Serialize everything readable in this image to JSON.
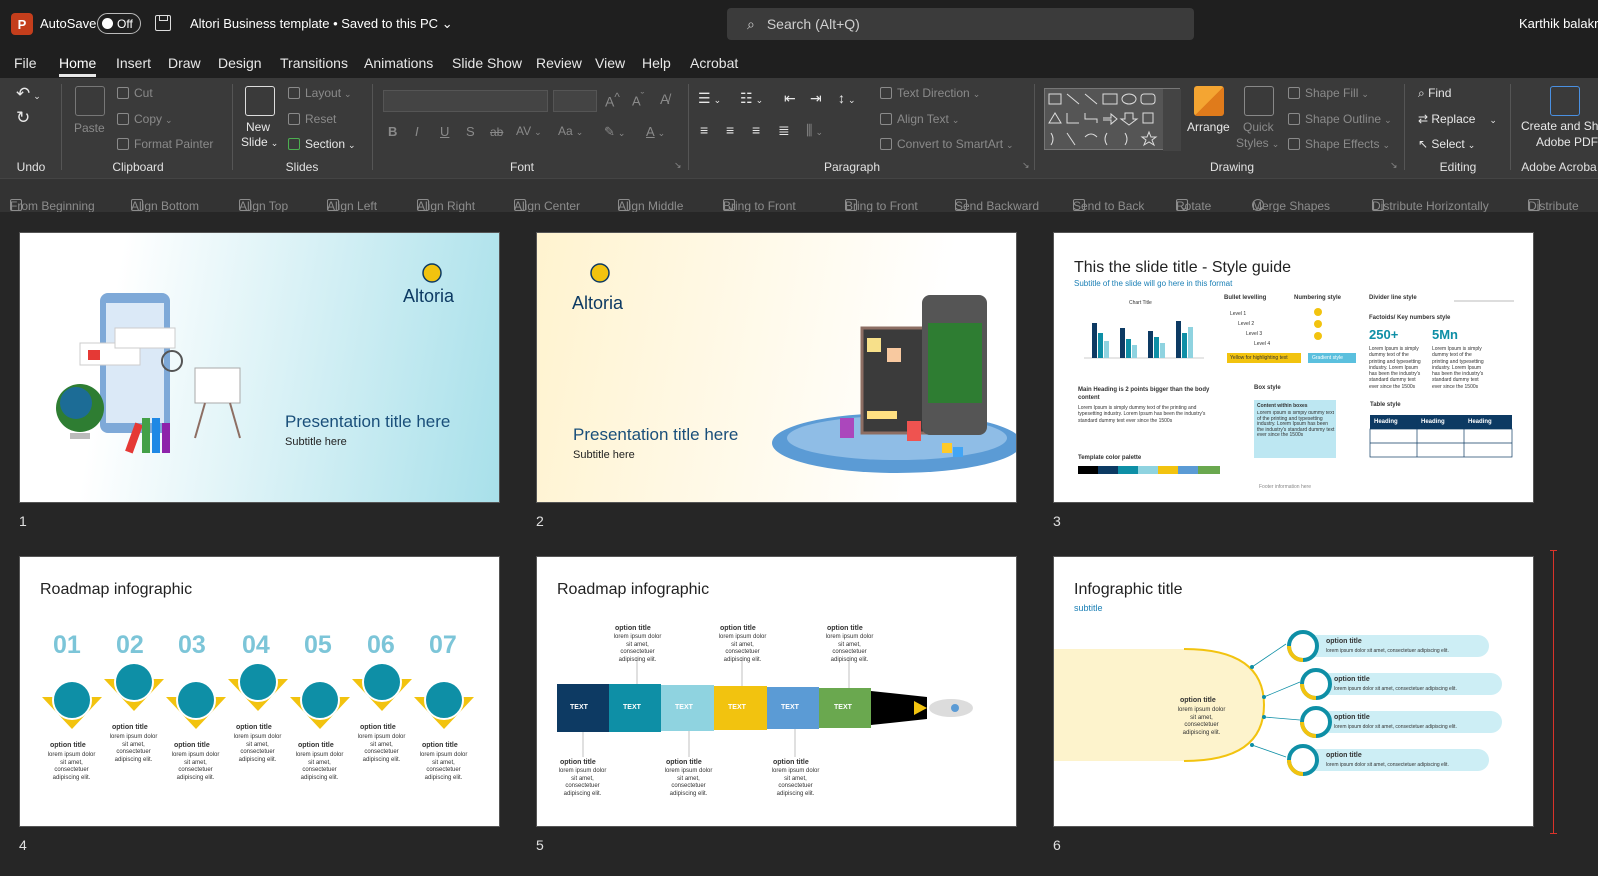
{
  "titlebar": {
    "app_logo": "P",
    "autosave_label": "AutoSave",
    "autosave_state": "Off",
    "document_title": "Altori Business template • Saved to this PC",
    "search_placeholder": "Search (Alt+Q)",
    "user_name": "Karthik balakris"
  },
  "menu": [
    "File",
    "Home",
    "Insert",
    "Draw",
    "Design",
    "Transitions",
    "Animations",
    "Slide Show",
    "Review",
    "View",
    "Help",
    "Acrobat"
  ],
  "ribbon": {
    "groups": {
      "undo": "Undo",
      "clipboard": "Clipboard",
      "slides": "Slides",
      "font": "Font",
      "paragraph": "Paragraph",
      "drawing": "Drawing",
      "editing": "Editing",
      "acrobat": "Adobe Acroba"
    },
    "clipboard": {
      "paste": "Paste",
      "cut": "Cut",
      "copy": "Copy",
      "format_painter": "Format Painter"
    },
    "slides": {
      "new_slide_1": "New",
      "new_slide_2": "Slide",
      "layout": "Layout",
      "reset": "Reset",
      "section": "Section"
    },
    "font": {
      "bold": "B",
      "italic": "I",
      "underline": "U",
      "shadow": "S",
      "strike": "ab",
      "spacing": "AV",
      "case": "Aa",
      "color": "A"
    },
    "paragraph": {
      "text_direction": "Text Direction",
      "align_text": "Align Text",
      "convert_smartart": "Convert to SmartArt"
    },
    "drawing": {
      "arrange": "Arrange",
      "quick_styles_1": "Quick",
      "quick_styles_2": "Styles",
      "shape_fill": "Shape Fill",
      "shape_outline": "Shape Outline",
      "shape_effects": "Shape Effects"
    },
    "editing": {
      "find": "Find",
      "replace": "Replace",
      "select": "Select"
    },
    "acrobat": {
      "create_1": "Create and Sha",
      "create_2": "Adobe PDF"
    }
  },
  "quick_access": [
    "From Beginning",
    "Align Bottom",
    "Align Top",
    "Align Left",
    "Align Right",
    "Align Center",
    "Align Middle",
    "Bring to Front",
    "Bring to Front",
    "Send Backward",
    "Send to Back",
    "Rotate",
    "Merge Shapes",
    "Distribute Horizontally",
    "Distribute"
  ],
  "slides": [
    {
      "number": "1",
      "logo": "Altoria",
      "title": "Presentation title here",
      "subtitle": "Subtitle here"
    },
    {
      "number": "2",
      "logo": "Altoria",
      "title": "Presentation title here",
      "subtitle": "Subtitle here"
    },
    {
      "number": "3",
      "title": "This the slide title - Style guide",
      "subtitle": "Subtitle of the slide will go here in this format",
      "bullet": "Bullet levelling",
      "levels": [
        "Level 1",
        "Level 2",
        "Level 3",
        "Level 4"
      ],
      "numbering": "Numbering style",
      "divider": "Divider line style",
      "factoids": "Factoids/ Key numbers style",
      "fact1": "250+",
      "fact2": "5Mn",
      "yellow": "Yellow for highlighting text",
      "gradient": "Gradient style",
      "main_heading": "Main Heading is 2 points bigger than the body content",
      "box_style": "Box style",
      "content_box": "Content within boxes",
      "table_style": "Table style",
      "heading": "Heading",
      "palette": "Template color palette",
      "footer": "Footer information here",
      "chart_title": "Chart Title",
      "lorem": "Lorem Ipsum is simply dummy text of the printing and typesetting industry. Lorem Ipsum has been the industry's standard dummy text ever since the 1500s"
    },
    {
      "number": "4",
      "title": "Roadmap infographic",
      "steps": [
        "01",
        "02",
        "03",
        "04",
        "05",
        "06",
        "07"
      ],
      "option": "option title",
      "lorem": "lorem ipsum dolor sit amet, consectetuer adipiscing elit."
    },
    {
      "number": "5",
      "title": "Roadmap infographic",
      "segment": "TEXT",
      "option": "option title",
      "lorem": "lorem ipsum dolor sit amet, consectetuer adipiscing elit."
    },
    {
      "number": "6",
      "title": "Infographic title",
      "subtitle": "subtitle",
      "option": "option title",
      "lorem": "lorem ipsum dolor sit amet, consectetuer adipiscing elit."
    }
  ],
  "colors": {
    "accent_blue": "#1a7fb5",
    "teal": "#0e8fa6",
    "navy": "#0d3a63",
    "yellow": "#f2c30f",
    "green": "#6aa84f"
  }
}
